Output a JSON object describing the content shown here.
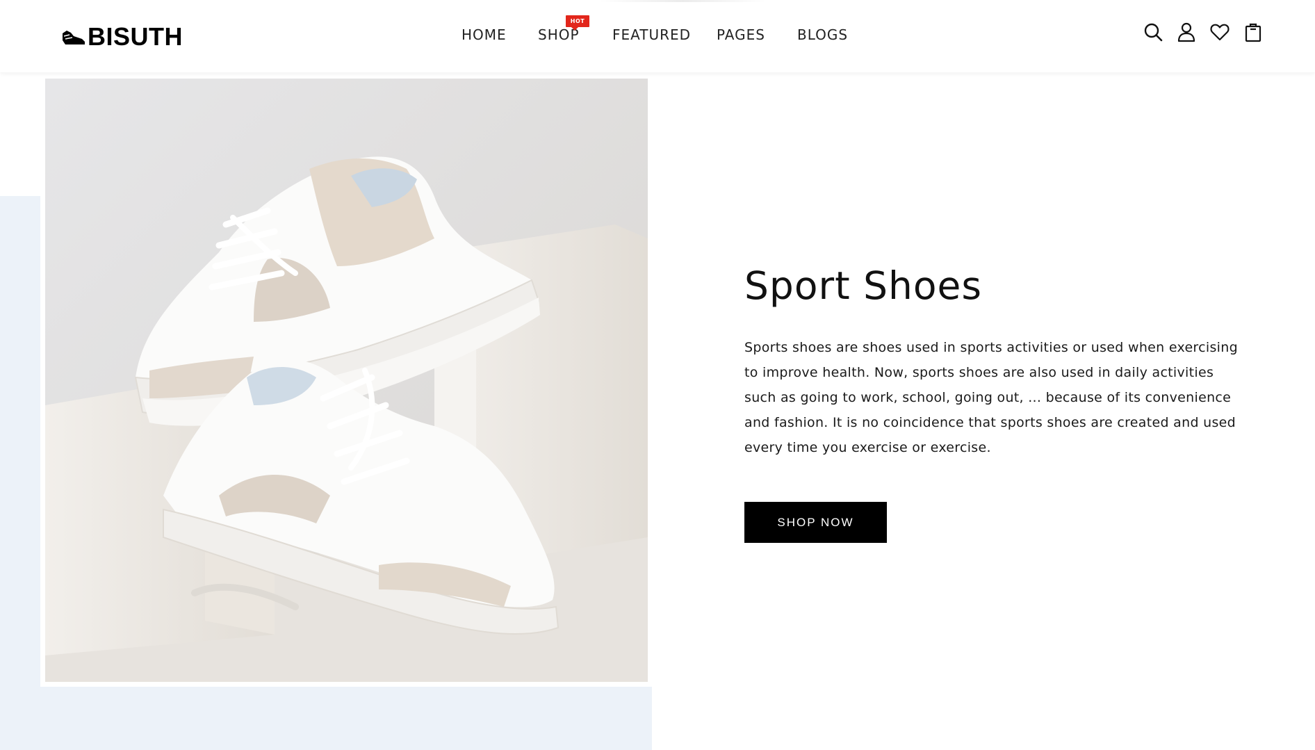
{
  "header": {
    "logo_text": "BISUTH",
    "nav": [
      {
        "label": "HOME"
      },
      {
        "label": "SHOP",
        "badge": "HOT"
      },
      {
        "label": "FEATURED"
      },
      {
        "label": "PAGES"
      },
      {
        "label": "BLOGS"
      }
    ],
    "icons": [
      "search-icon",
      "user-icon",
      "heart-icon",
      "shopping-bag-icon"
    ]
  },
  "hero": {
    "title": "Sport Shoes",
    "description": "Sports shoes are shoes used in sports activities or used when exercising to improve health. Now, sports shoes are also used in daily activities such as going to work, school, going out, ... because of its convenience and fashion. It is no coincidence that sports shoes are created and used every time you exercise or exercise.",
    "cta_label": "SHOP NOW"
  },
  "colors": {
    "accent_badge": "#e2261b",
    "panel_bg": "#ecf2f9",
    "button_bg": "#000000"
  }
}
